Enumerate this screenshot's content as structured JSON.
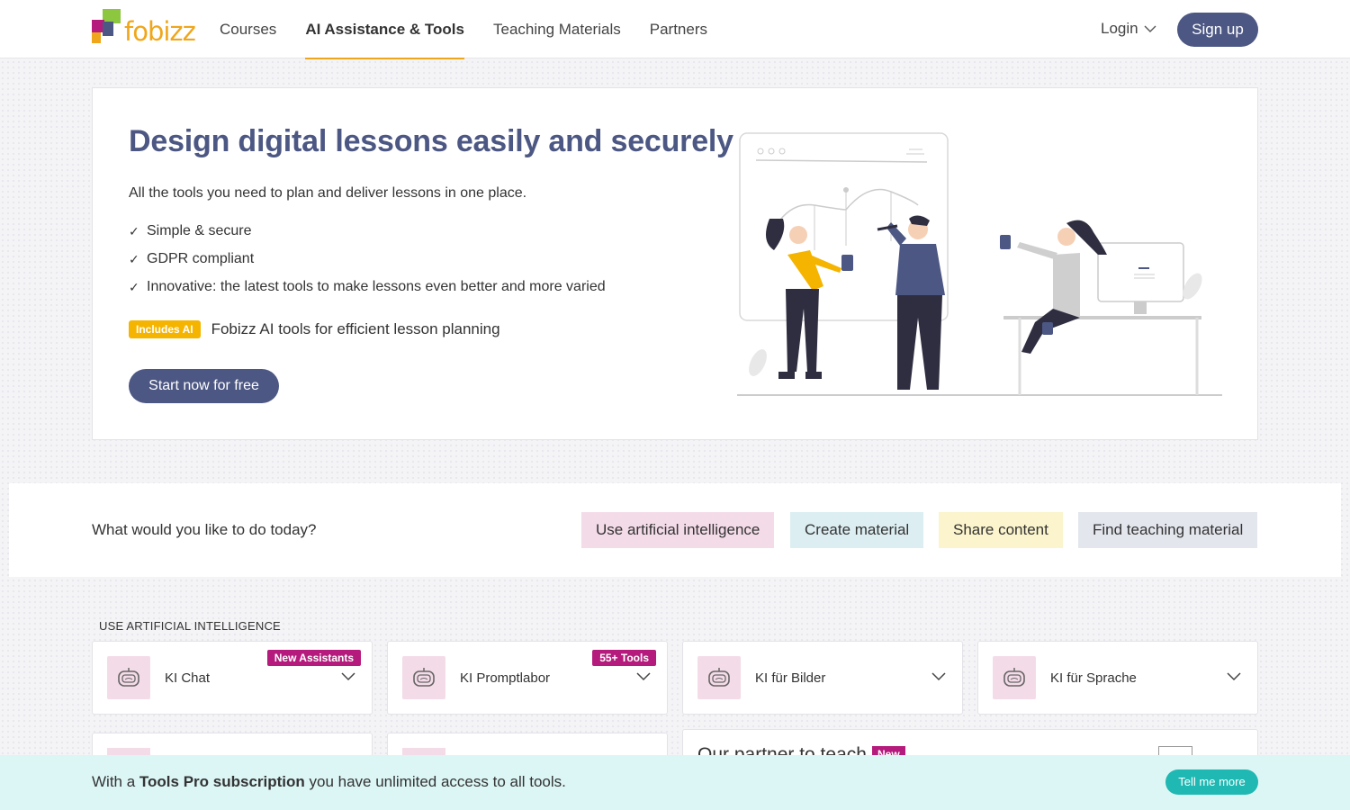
{
  "header": {
    "logo_text": "fobizz",
    "nav": [
      "Courses",
      "AI Assistance & Tools",
      "Teaching Materials",
      "Partners"
    ],
    "active_nav": "AI Assistance & Tools",
    "login": "Login",
    "signup": "Sign up"
  },
  "hero": {
    "title": "Design digital lessons easily and securely",
    "lead": "All the tools you need to plan and deliver lessons in one place.",
    "features": [
      "Simple & secure",
      "GDPR compliant",
      "Innovative: the latest tools to make lessons even better and more varied"
    ],
    "ai_badge": "Includes AI",
    "ai_text": "Fobizz AI tools for efficient lesson planning",
    "cta": "Start now for free"
  },
  "today": {
    "question": "What would you like to do today?",
    "chips": [
      {
        "label": "Use artificial intelligence",
        "color": "#f4dbe8"
      },
      {
        "label": "Create material",
        "color": "#dceef2"
      },
      {
        "label": "Share content",
        "color": "#fbf4cc"
      },
      {
        "label": "Find teaching material",
        "color": "#e4e6ee"
      }
    ]
  },
  "section": {
    "title": "USE ARTIFICIAL INTELLIGENCE",
    "cards": [
      {
        "label": "KI Chat",
        "tag": "New Assistants",
        "icon": "robot-icon"
      },
      {
        "label": "KI Promptlabor",
        "tag": "55+ Tools",
        "icon": "robot-icon"
      },
      {
        "label": "KI für Bilder",
        "tag": "",
        "icon": "robot-icon"
      },
      {
        "label": "KI für Sprache",
        "tag": "",
        "icon": "robot-icon"
      }
    ],
    "partner_title": "Our partner to teach",
    "partner_badge": "New"
  },
  "banner": {
    "prefix": "With a ",
    "bold": "Tools Pro subscription",
    "suffix": " you have unlimited access to all tools.",
    "button": "Tell me more"
  },
  "colors": {
    "primary": "#4c5783",
    "accent": "#f0a61a",
    "magenta": "#b51b7c",
    "teal": "#1fb8b2"
  }
}
